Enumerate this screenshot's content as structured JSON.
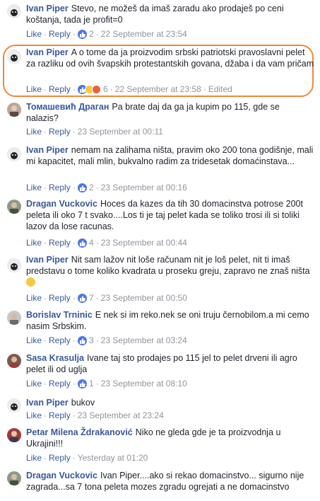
{
  "comments": [
    {
      "name": "Ivan Piper",
      "text": "Stevo, ne možeš da imaš zaradu ako prodaješ po ceni koštanja, tada je profit=0",
      "like": "Like",
      "reply": "Reply",
      "reactions": "2",
      "time": "22 September at 23:54",
      "avatar": "ivan"
    },
    {
      "name": "Ivan Piper",
      "text": "A o tome da ja proizvodim srbski patriotski pravoslavni pelet za razliku od ovih švapskih protestantskih govana, džaba i da vam pričam",
      "like": "Like",
      "reply": "Reply",
      "reactions": "6",
      "time": "22 September at 23:58",
      "edited": "Edited",
      "avatar": "ivan"
    },
    {
      "name": "Томашевић Драган",
      "text": "Pa brate daj da ga ja kupim po 115, gde se nalazis?",
      "like": "Like",
      "reply": "Reply",
      "time": "23 September at 00:11",
      "avatar": "tomasevic"
    },
    {
      "name": "Ivan Piper",
      "text": "nemam na zalihama ništa, pravim oko 200 tona godišnje, mali mi kapacitet, mali mlin, bukvalno radim za tridesetak domaćinstava...",
      "like": "Like",
      "reply": "Reply",
      "reactions": "2",
      "time": "23 September at 00:16",
      "avatar": "ivan"
    },
    {
      "name": "Dragan Vuckovic",
      "text": "Hoces da kazes da tih 30 domacinstva potrose 200t peleta ili oko 7 t svako....Los ti je taj pelet kada se toliko trosi ili si toliki lazov da lose racunas.",
      "like": "Like",
      "reply": "Reply",
      "reactions": "4",
      "time": "23 September at 00:44",
      "avatar": "dragan"
    },
    {
      "name": "Ivan Piper",
      "text": "Nit sam lažov nit loše računam nit je loš pelet, nit ti imaš predstavu o tome koliko kvadrata u proseku greju, zapravo ne znaš ništa",
      "like": "Like",
      "reply": "Reply",
      "reactions": "7",
      "time": "23 September at 00:50",
      "avatar": "ivan"
    },
    {
      "name": "Borislav Trninic",
      "text": "E nek si im reko.nek se oni truju černobilom.a mi cemo nasim Srbskim.",
      "like": "Like",
      "reply": "Reply",
      "reactions": "3",
      "time": "23 September at 03:24",
      "avatar": "borislav"
    },
    {
      "name": "Sasa Krasulja",
      "text": "Ivane taj sto prodajes po 115 jel to pelet drveni ili agro pelet ili od uglja",
      "like": "Like",
      "reply": "Reply",
      "reactions": "1",
      "time": "23 September at 08:10",
      "avatar": "sasa"
    },
    {
      "name": "Ivan Piper",
      "text": "bukov",
      "like": "Like",
      "reply": "Reply",
      "time": "23 September at 23:24",
      "avatar": "ivan"
    },
    {
      "name": "Petar Milena Ždrakanović",
      "text": "Niko ne gleda gde je ta proizvodnja u Ukrajini!!!",
      "like": "Like",
      "reply": "Reply",
      "time": "Yesterday at 01:20",
      "avatar": "petar"
    },
    {
      "name": "Dragan Vuckovic",
      "text": "Ivan Piper....ako si rekao domacinstvo... sigurno nije zagrada...sa 7 tona peleta mozes zgradu ogrejati a ne domacinstvo",
      "avatar": "dragan"
    }
  ],
  "colors": {
    "name": "#385898",
    "highlight": "#f0883a",
    "meta": "#90949c",
    "like_icon": "#4a76e8"
  }
}
